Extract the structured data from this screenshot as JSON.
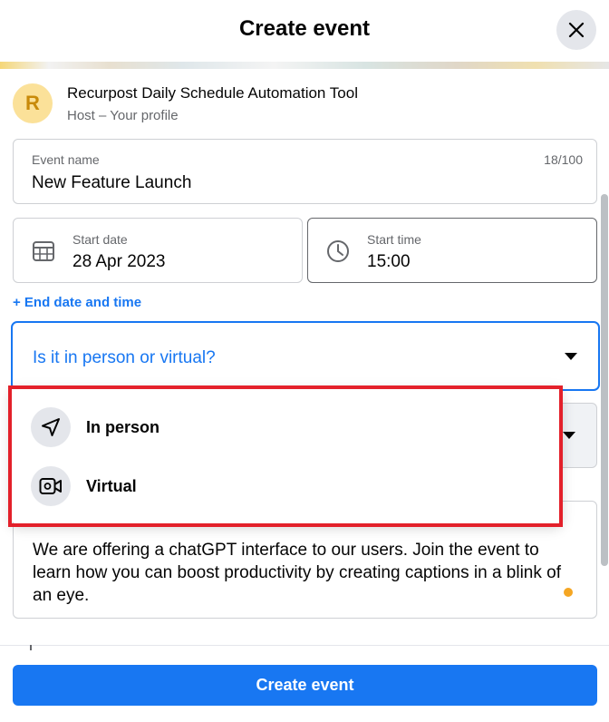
{
  "header": {
    "title": "Create event"
  },
  "host": {
    "initial": "R",
    "name": "Recurpost Daily Schedule Automation Tool",
    "role": "Host – Your profile"
  },
  "event_name": {
    "label": "Event name",
    "value": "New Feature Launch",
    "count": "18/100"
  },
  "start_date": {
    "label": "Start date",
    "value": "28 Apr 2023"
  },
  "start_time": {
    "label": "Start time",
    "value": "15:00"
  },
  "end_link": "+ End date and time",
  "venue": {
    "placeholder": "Is it in person or virtual?",
    "options": [
      {
        "label": "In person",
        "icon": "navigation-arrow-icon"
      },
      {
        "label": "Virtual",
        "icon": "video-camera-icon"
      }
    ]
  },
  "description": {
    "value": "We are offering a chatGPT interface to our users. Join the event to learn how you can boost productivity by creating captions in a blink of an eye."
  },
  "footer": {
    "create_label": "Create event"
  },
  "colors": {
    "accent": "#1877f2",
    "highlight": "#e3202a",
    "avatar_bg": "#fbe199"
  }
}
